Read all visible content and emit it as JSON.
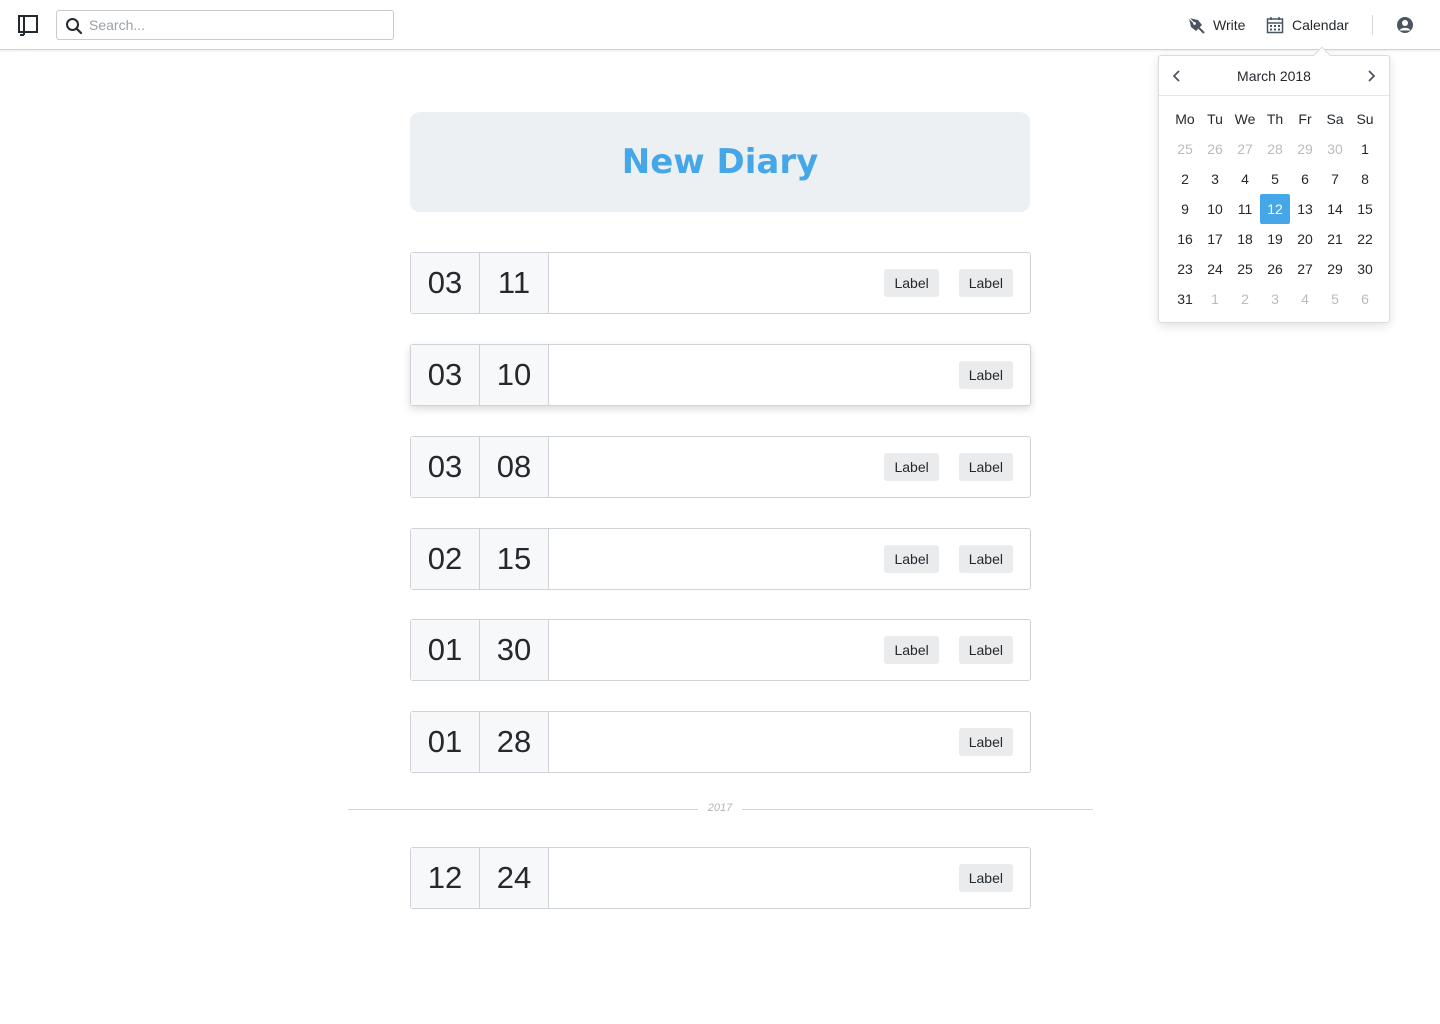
{
  "header": {
    "search_placeholder": "Search...",
    "write_label": "Write",
    "calendar_label": "Calendar"
  },
  "calendar": {
    "title": "March 2018",
    "weekdays": [
      "Mo",
      "Tu",
      "We",
      "Th",
      "Fr",
      "Sa",
      "Su"
    ],
    "days": [
      {
        "d": "25",
        "muted": true
      },
      {
        "d": "26",
        "muted": true
      },
      {
        "d": "27",
        "muted": true
      },
      {
        "d": "28",
        "muted": true
      },
      {
        "d": "29",
        "muted": true
      },
      {
        "d": "30",
        "muted": true
      },
      {
        "d": "1"
      },
      {
        "d": "2"
      },
      {
        "d": "3"
      },
      {
        "d": "4"
      },
      {
        "d": "5"
      },
      {
        "d": "6"
      },
      {
        "d": "7"
      },
      {
        "d": "8"
      },
      {
        "d": "9"
      },
      {
        "d": "10"
      },
      {
        "d": "11"
      },
      {
        "d": "12",
        "selected": true
      },
      {
        "d": "13"
      },
      {
        "d": "14"
      },
      {
        "d": "15"
      },
      {
        "d": "16"
      },
      {
        "d": "17"
      },
      {
        "d": "18"
      },
      {
        "d": "19"
      },
      {
        "d": "20"
      },
      {
        "d": "21"
      },
      {
        "d": "22"
      },
      {
        "d": "23"
      },
      {
        "d": "24"
      },
      {
        "d": "25"
      },
      {
        "d": "26"
      },
      {
        "d": "27"
      },
      {
        "d": "29"
      },
      {
        "d": "30"
      },
      {
        "d": "31"
      },
      {
        "d": "1",
        "muted": true
      },
      {
        "d": "2",
        "muted": true
      },
      {
        "d": "3",
        "muted": true
      },
      {
        "d": "4",
        "muted": true
      },
      {
        "d": "5",
        "muted": true
      },
      {
        "d": "6",
        "muted": true
      }
    ]
  },
  "banner": {
    "title": "New Diary"
  },
  "entries": [
    {
      "month": "03",
      "day": "11",
      "labels": [
        "Label",
        "Label"
      ]
    },
    {
      "month": "03",
      "day": "10",
      "labels": [
        "Label"
      ]
    },
    {
      "month": "03",
      "day": "08",
      "labels": [
        "Label",
        "Label"
      ]
    },
    {
      "month": "02",
      "day": "15",
      "labels": [
        "Label",
        "Label"
      ]
    },
    {
      "month": "01",
      "day": "30",
      "labels": [
        "Label",
        "Label"
      ]
    },
    {
      "month": "01",
      "day": "28",
      "labels": [
        "Label"
      ]
    }
  ],
  "year_separator": "2017",
  "entries_2017": [
    {
      "month": "12",
      "day": "24",
      "labels": [
        "Label"
      ]
    }
  ],
  "colors": {
    "accent": "#46a7e8",
    "banner_bg": "#ecf0f3"
  }
}
